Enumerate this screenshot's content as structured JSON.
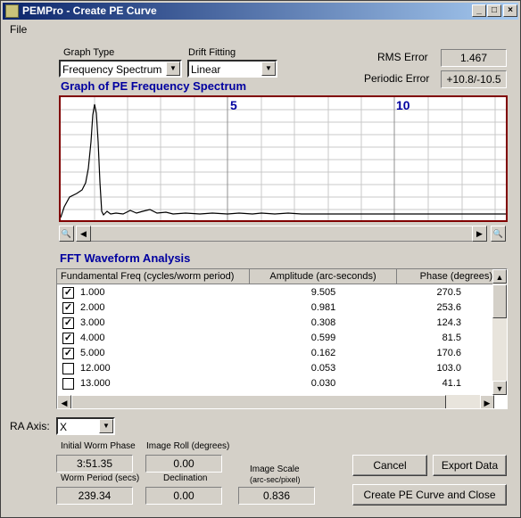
{
  "window": {
    "title": "PEMPro - Create PE Curve"
  },
  "menu": {
    "file": "File"
  },
  "controls": {
    "graph_type_label": "Graph Type",
    "graph_type_value": "Frequency Spectrum",
    "drift_label": "Drift Fitting",
    "drift_value": "Linear",
    "rms_label": "RMS Error",
    "rms_value": "1.467",
    "periodic_label": "Periodic Error",
    "periodic_value": "+10.8/-10.5"
  },
  "graph": {
    "title": "Graph of PE Frequency Spectrum",
    "marker_5": "5",
    "marker_10": "10"
  },
  "fft": {
    "title": "FFT Waveform Analysis",
    "headers": [
      "Fundamental Freq (cycles/worm period)",
      "Amplitude (arc-seconds)",
      "Phase (degrees)"
    ],
    "rows": [
      {
        "checked": true,
        "freq": "1.000",
        "amp": "9.505",
        "phase": "270.5"
      },
      {
        "checked": true,
        "freq": "2.000",
        "amp": "0.981",
        "phase": "253.6"
      },
      {
        "checked": true,
        "freq": "3.000",
        "amp": "0.308",
        "phase": "124.3"
      },
      {
        "checked": true,
        "freq": "4.000",
        "amp": "0.599",
        "phase": "81.5"
      },
      {
        "checked": true,
        "freq": "5.000",
        "amp": "0.162",
        "phase": "170.6"
      },
      {
        "checked": false,
        "freq": "12.000",
        "amp": "0.053",
        "phase": "103.0"
      },
      {
        "checked": false,
        "freq": "13.000",
        "amp": "0.030",
        "phase": "41.1"
      }
    ]
  },
  "bottom": {
    "ra_axis_label": "RA Axis:",
    "ra_axis_value": "X",
    "initial_phase_label": "Initial Worm Phase",
    "initial_phase_value": "3:51.35",
    "image_roll_label": "Image Roll (degrees)",
    "image_roll_value": "0.00",
    "worm_period_label": "Worm Period (secs)",
    "worm_period_value": "239.34",
    "declination_label": "Declination",
    "declination_value": "0.00",
    "image_scale_label": "Image Scale",
    "image_scale_sub": "(arc-sec/pixel)",
    "image_scale_value": "0.836",
    "cancel": "Cancel",
    "export": "Export Data",
    "create": "Create PE Curve and Close"
  }
}
